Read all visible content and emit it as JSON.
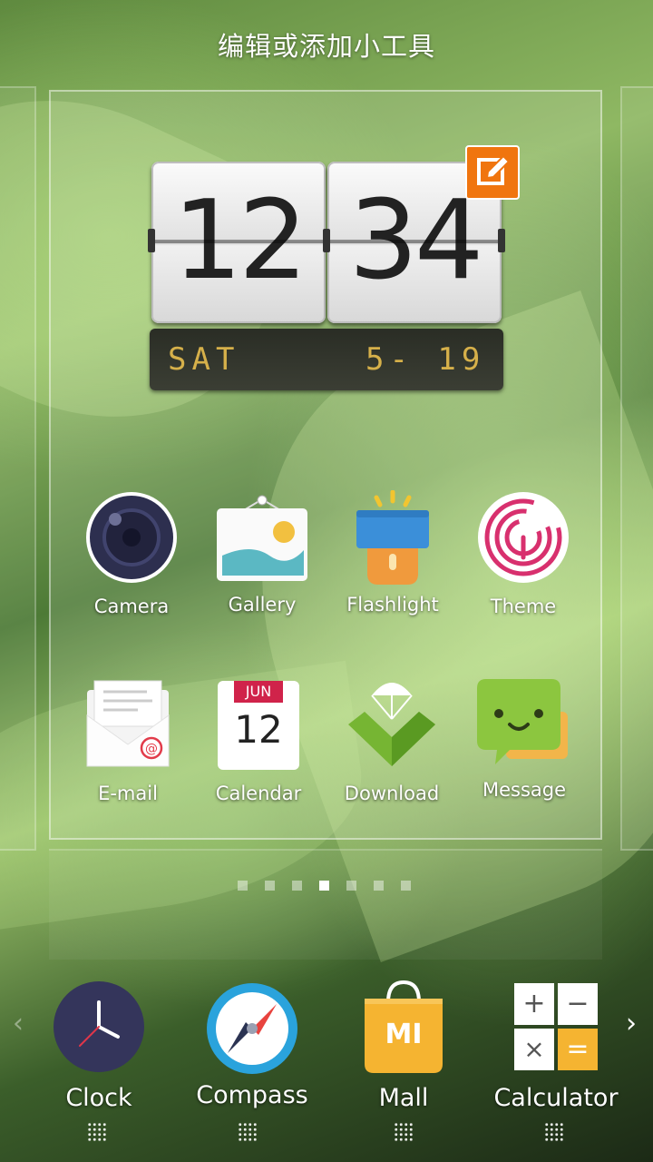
{
  "header": {
    "title": "编辑或添加小工具"
  },
  "clock_widget": {
    "hours": "12",
    "minutes": "34",
    "day": "SAT",
    "date": "5- 19"
  },
  "apps": [
    {
      "label": "Camera",
      "icon": "camera-icon"
    },
    {
      "label": "Gallery",
      "icon": "gallery-icon"
    },
    {
      "label": "Flashlight",
      "icon": "flashlight-icon"
    },
    {
      "label": "Theme",
      "icon": "theme-icon"
    },
    {
      "label": "E-mail",
      "icon": "email-icon"
    },
    {
      "label": "Calendar",
      "icon": "calendar-icon",
      "month": "JUN",
      "day": "12"
    },
    {
      "label": "Download",
      "icon": "download-icon"
    },
    {
      "label": "Message",
      "icon": "message-icon"
    }
  ],
  "pager": {
    "count": 7,
    "active_index": 3
  },
  "dock": [
    {
      "label": "Clock",
      "icon": "clock-icon"
    },
    {
      "label": "Compass",
      "icon": "compass-icon"
    },
    {
      "label": "Mall",
      "icon": "mall-icon",
      "logo_text": "MI"
    },
    {
      "label": "Calculator",
      "icon": "calculator-icon",
      "keys": [
        "+",
        "−",
        "×",
        "="
      ]
    }
  ],
  "navigation": {
    "prev": "‹",
    "next": "›"
  },
  "colors": {
    "accent_orange": "#f0750f",
    "calendar_red": "#d0234a",
    "download_green": "#76b533",
    "message_green": "#8cc63f"
  }
}
